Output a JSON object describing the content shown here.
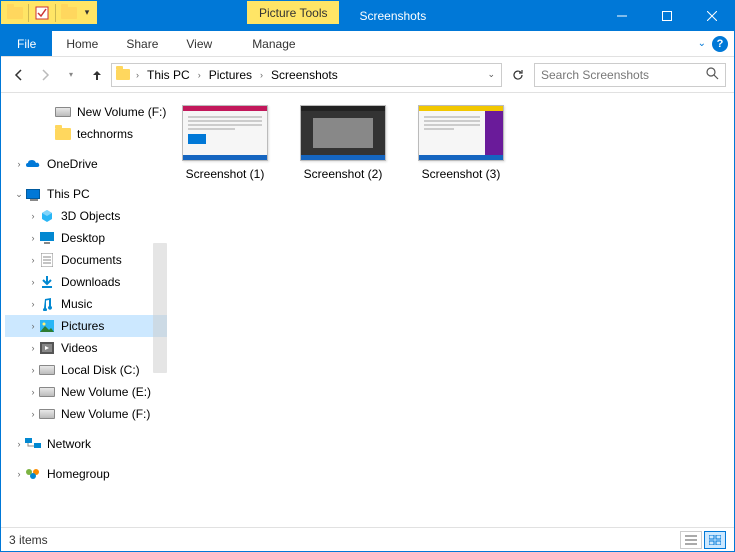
{
  "window": {
    "title": "Screenshots",
    "contextual_tab": "Picture Tools"
  },
  "ribbon": {
    "file": "File",
    "tabs": [
      "Home",
      "Share",
      "View"
    ],
    "manage": "Manage"
  },
  "breadcrumbs": [
    "This PC",
    "Pictures",
    "Screenshots"
  ],
  "search": {
    "placeholder": "Search Screenshots"
  },
  "sidebar": {
    "top_items": [
      {
        "label": "New Volume (F:)",
        "icon": "drive"
      },
      {
        "label": "technorms",
        "icon": "folder"
      }
    ],
    "onedrive": {
      "label": "OneDrive"
    },
    "thispc": {
      "label": "This PC"
    },
    "pc_children": [
      {
        "label": "3D Objects"
      },
      {
        "label": "Desktop"
      },
      {
        "label": "Documents"
      },
      {
        "label": "Downloads"
      },
      {
        "label": "Music"
      },
      {
        "label": "Pictures",
        "selected": true
      },
      {
        "label": "Videos"
      },
      {
        "label": "Local Disk (C:)"
      },
      {
        "label": "New Volume (E:)"
      },
      {
        "label": "New Volume (F:)"
      }
    ],
    "network": {
      "label": "Network"
    },
    "homegroup": {
      "label": "Homegroup"
    }
  },
  "files": [
    {
      "label": "Screenshot (1)",
      "style": "light"
    },
    {
      "label": "Screenshot (2)",
      "style": "dark"
    },
    {
      "label": "Screenshot (3)",
      "style": "yellow"
    }
  ],
  "status": {
    "text": "3 items"
  }
}
